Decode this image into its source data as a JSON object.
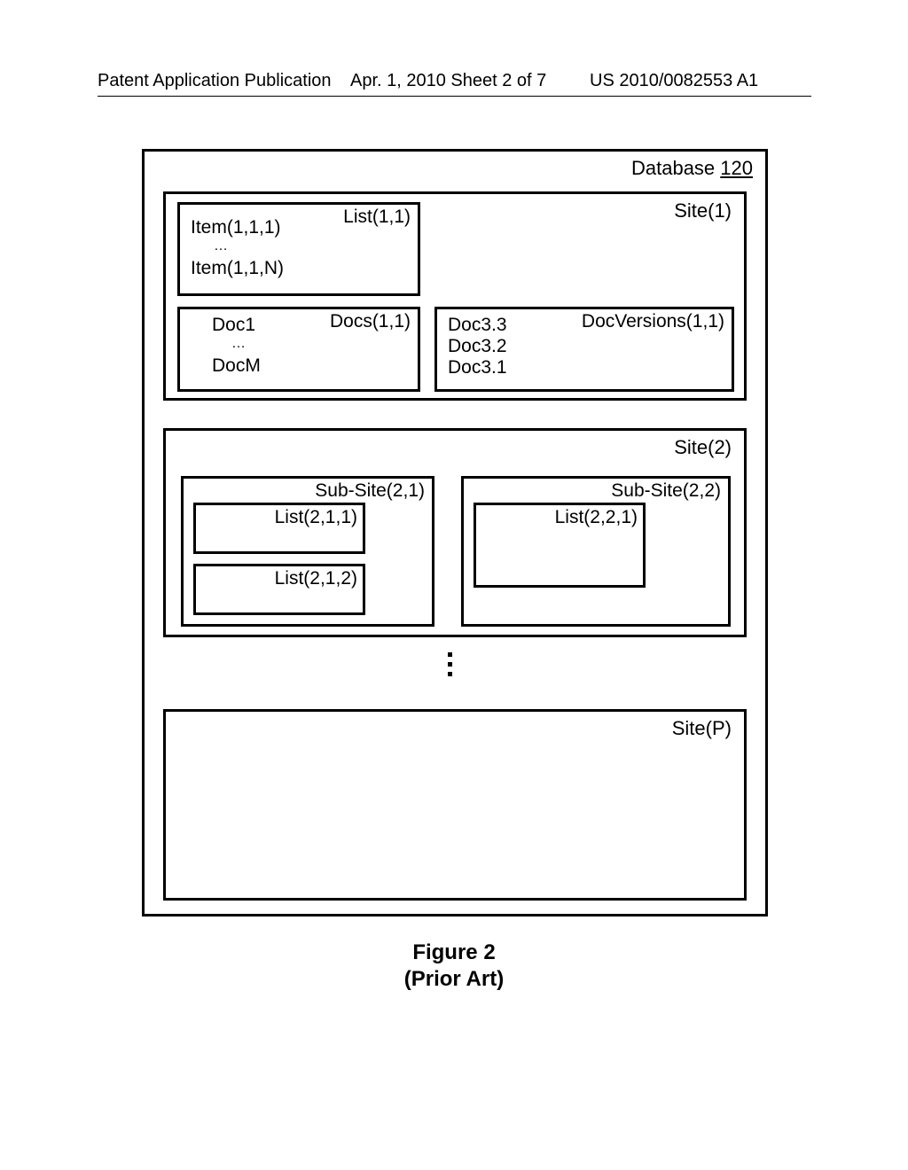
{
  "header": {
    "left": "Patent Application Publication",
    "center": "Apr. 1, 2010  Sheet 2 of 7",
    "right": "US 2010/0082553 A1"
  },
  "db": {
    "label_prefix": "Database ",
    "number": "120"
  },
  "site1": {
    "label": "Site(1)",
    "list": {
      "label": "List(1,1)",
      "item_first": "Item(1,1,1)",
      "dots": "…",
      "item_last": "Item(1,1,N)"
    },
    "docs": {
      "label": "Docs(1,1)",
      "first": "Doc1",
      "dots": "…",
      "last": "DocM"
    },
    "docversions": {
      "label": "DocVersions(1,1)",
      "v3": "Doc3.3",
      "v2": "Doc3.2",
      "v1": "Doc3.1"
    }
  },
  "site2": {
    "label": "Site(2)",
    "sub1": {
      "label": "Sub-Site(2,1)",
      "list1": "List(2,1,1)",
      "list2": "List(2,1,2)"
    },
    "sub2": {
      "label": "Sub-Site(2,2)",
      "list1": "List(2,2,1)"
    }
  },
  "siteP": {
    "label": "Site(P)"
  },
  "caption": {
    "line1": "Figure 2",
    "line2": "(Prior Art)"
  }
}
